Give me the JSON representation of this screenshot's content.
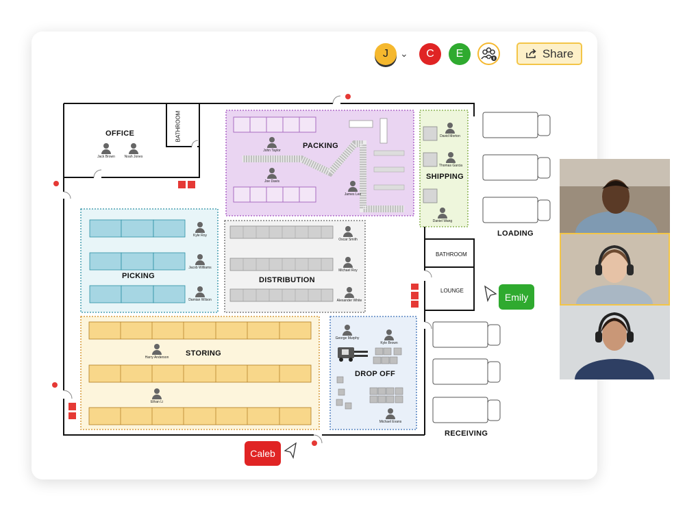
{
  "toolbar": {
    "avatars": [
      {
        "initial": "J",
        "color": "#f5b82e"
      },
      {
        "initial": "C",
        "color": "#e02424"
      },
      {
        "initial": "E",
        "color": "#2faa2f"
      }
    ],
    "share_label": "Share"
  },
  "floorplan": {
    "rooms": {
      "office": "OFFICE",
      "bathroom_top": "BATHROOM",
      "packing": "PACKING",
      "shipping": "SHIPPING",
      "loading": "LOADING",
      "picking": "PICKING",
      "distribution": "DISTRIBUTION",
      "bathroom_right": "BATHROOM",
      "lounge": "LOUNGE",
      "storing": "STORING",
      "drop_off": "DROP OFF",
      "receiving": "RECEIVING"
    },
    "people": {
      "jack_brown": "Jack Brown",
      "noah_jones": "Noah Jones",
      "john_taylor": "John Taylor",
      "joe_davis": "Joe Davis",
      "james_lee": "James Lee",
      "david_morton": "David Morton",
      "thomas_garcia": "Thomas Garcia",
      "daniel_wang": "Daniel Wang",
      "kyle_roy": "Kyle Roy",
      "jacob_williams": "Jacob Williams",
      "damian_wilson": "Damian Wilson",
      "oscar_smith": "Oscar Smith",
      "michael_roy": "Michael Roy",
      "alexander_white": "Alexander White",
      "harry_anderson": "Harry Anderson",
      "ethan_li": "Ethan Li",
      "george_murphy": "George Murphy",
      "kyle_brown": "Kyle Brown",
      "michael_evans": "Michael Evans"
    }
  },
  "cursors": {
    "emily": {
      "label": "Emily",
      "color": "#2faa2f"
    },
    "caleb": {
      "label": "Caleb",
      "color": "#e02424"
    }
  },
  "colors": {
    "packing": "#ead5f2",
    "shipping": "#eef6dc",
    "picking": "#e8f5f8",
    "distribution": "#f2f2f2",
    "storing": "#fdf5dc",
    "drop_off": "#e9f0f9",
    "share_bg": "#fdf0c8"
  }
}
